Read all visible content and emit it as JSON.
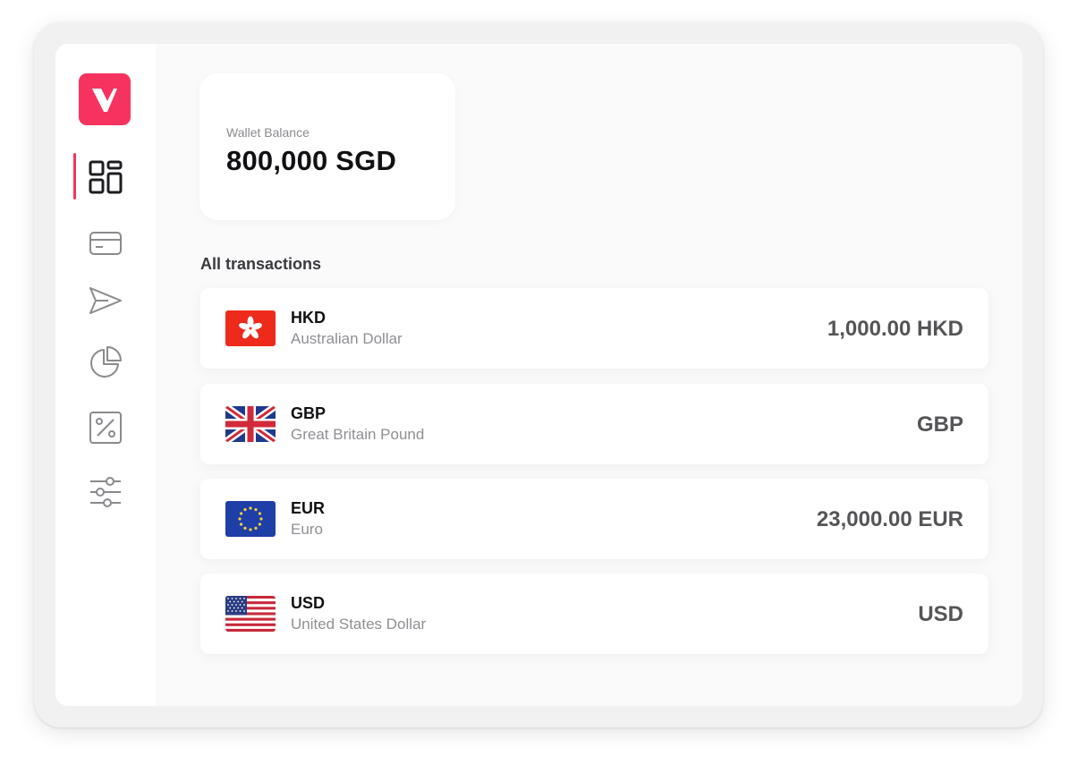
{
  "sidebar": {
    "logo": "V",
    "items": [
      {
        "name": "dashboard",
        "icon": "dashboard-icon",
        "active": true
      },
      {
        "name": "cards",
        "icon": "card-icon",
        "active": false
      },
      {
        "name": "send",
        "icon": "send-icon",
        "active": false
      },
      {
        "name": "analytics",
        "icon": "pie-chart-icon",
        "active": false
      },
      {
        "name": "discounts",
        "icon": "percent-icon",
        "active": false
      },
      {
        "name": "settings",
        "icon": "sliders-icon",
        "active": false
      }
    ]
  },
  "colors": {
    "accent": "#f6335f",
    "text_primary": "#111114",
    "text_secondary": "#8f8f94",
    "amount": "#555558"
  },
  "wallet": {
    "label": "Wallet Balance",
    "value": "800,000 SGD"
  },
  "transactions": {
    "title": "All transactions",
    "rows": [
      {
        "code": "HKD",
        "name": "Australian Dollar",
        "amount": "1,000.00 HKD",
        "flag": "hk-flag-icon"
      },
      {
        "code": "GBP",
        "name": "Great Britain Pound",
        "amount": "GBP",
        "flag": "gb-flag-icon"
      },
      {
        "code": "EUR",
        "name": "Euro",
        "amount": "23,000.00 EUR",
        "flag": "eu-flag-icon"
      },
      {
        "code": "USD",
        "name": "United States Dollar",
        "amount": "USD",
        "flag": "us-flag-icon"
      }
    ]
  }
}
